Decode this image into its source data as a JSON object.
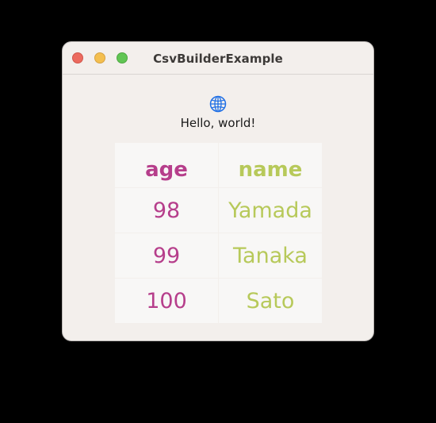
{
  "window": {
    "title": "CsvBuilderExample"
  },
  "content": {
    "icon": "globe-icon",
    "greeting": "Hello, world!"
  },
  "table": {
    "headers": [
      "age",
      "name"
    ],
    "rows": [
      [
        "98",
        "Yamada"
      ],
      [
        "99",
        "Tanaka"
      ],
      [
        "100",
        "Sato"
      ]
    ]
  },
  "colors": {
    "age_column": "#b63e8b",
    "name_column": "#b7c95a",
    "window_background": "#f3efec",
    "cell_background": "#f8f7f6",
    "globe_accent": "#1f6fe5"
  }
}
